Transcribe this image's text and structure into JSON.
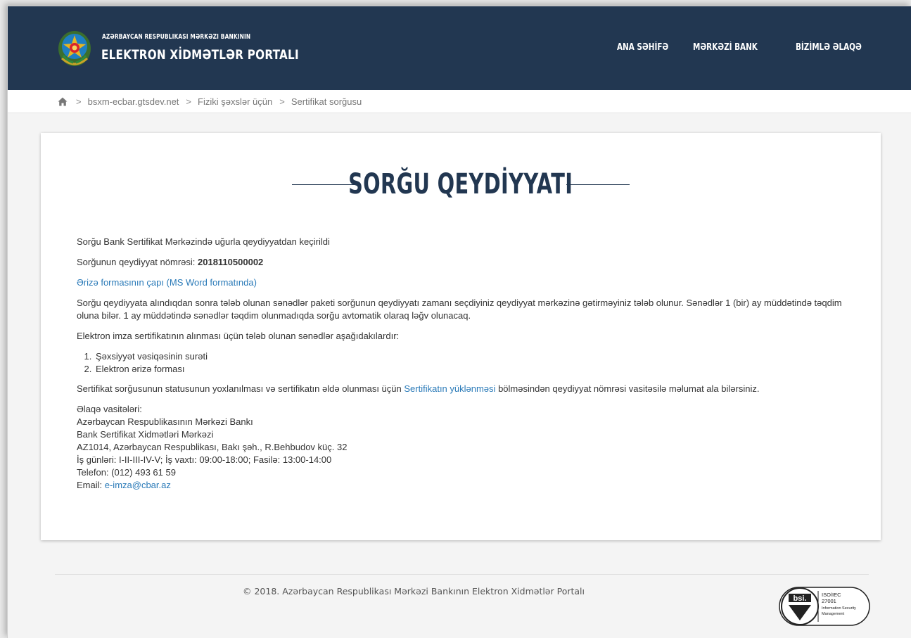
{
  "header": {
    "brand_small": "AZƏRBAYCAN RESPUBLİKASI MƏRKƏZİ BANKININ",
    "brand_big": "ELEKTRON XİDMƏTLƏR PORTALI",
    "nav": [
      "ANA SƏHİFƏ",
      "MƏRKƏZİ BANK",
      "BİZİMLƏ ƏLAQƏ"
    ]
  },
  "breadcrumb": {
    "sep": ">",
    "items": [
      "bsxm-ecbar.gtsdev.net",
      "Fiziki şəxslər üçün",
      "Sertifikat sorğusu"
    ]
  },
  "card": {
    "title": "SORĞU QEYDİYYATI",
    "success_msg": "Sorğu Bank Sertifikat Mərkəzində uğurla qeydiyyatdan keçirildi",
    "reg_label": "Sorğunun qeydiyyat nömrəsi:",
    "reg_number": "2018110500002",
    "print_link": "Ərizə formasının çapı (MS Word formatında)",
    "info_paragraph": "Sorğu qeydiyyata alındıqdan sonra tələb olunan sənədlər paketi sorğunun qeydiyyatı zamanı seçdiyiniz qeydiyyat mərkəzinə gətirməyiniz tələb olunur. Sənədlər 1 (bir) ay müddətində təqdim oluna bilər. 1 ay müddətində sənədlər təqdim olunmadıqda sorğu avtomatik olaraq ləğv olunacaq.",
    "docs_intro": "Elektron imza sertifikatının alınması üçün tələb olunan sənədlər aşağıdakılardır:",
    "docs": [
      "Şəxsiyyət vəsiqəsinin surəti",
      "Elektron ərizə forması"
    ],
    "status_before": "Sertifikat sorğusunun statusunun yoxlanılması və sertifikatın əldə olunması üçün",
    "status_link": "Sertifikatın yüklənməsi",
    "status_after": "bölməsindən qeydiyyat nömrəsi vasitəsilə məlumat ala bilərsiniz.",
    "contacts": {
      "heading": "Əlaqə vasitələri:",
      "org": "Azərbaycan Respublikasının Mərkəzi Bankı",
      "dept": "Bank Sertifikat Xidmətləri Mərkəzi",
      "address": "AZ1014, Azərbaycan Respublikası, Bakı şəh., R.Behbudov küç. 32",
      "hours": "İş günləri: I-II-III-IV-V; İş vaxtı: 09:00-18:00; Fasilə: 13:00-14:00",
      "phone": "Telefon: (012) 493 61 59",
      "email_label": "Email:",
      "email": "e-imza@cbar.az"
    }
  },
  "footer": {
    "copyright": "© 2018. Azərbaycan Respublikası Mərkəzi Bankının Elektron Xidmətlər Portalı",
    "bsi_brand": "bsi.",
    "bsi_lines": [
      "ISO/IEC",
      "27001",
      "Information Security",
      "Management"
    ]
  },
  "colors": {
    "header_bg": "#223751",
    "link": "#2a7ab8",
    "title": "#223751"
  },
  "icons": [
    "emblem-icon",
    "home-icon",
    "bsi-heart-icon"
  ]
}
